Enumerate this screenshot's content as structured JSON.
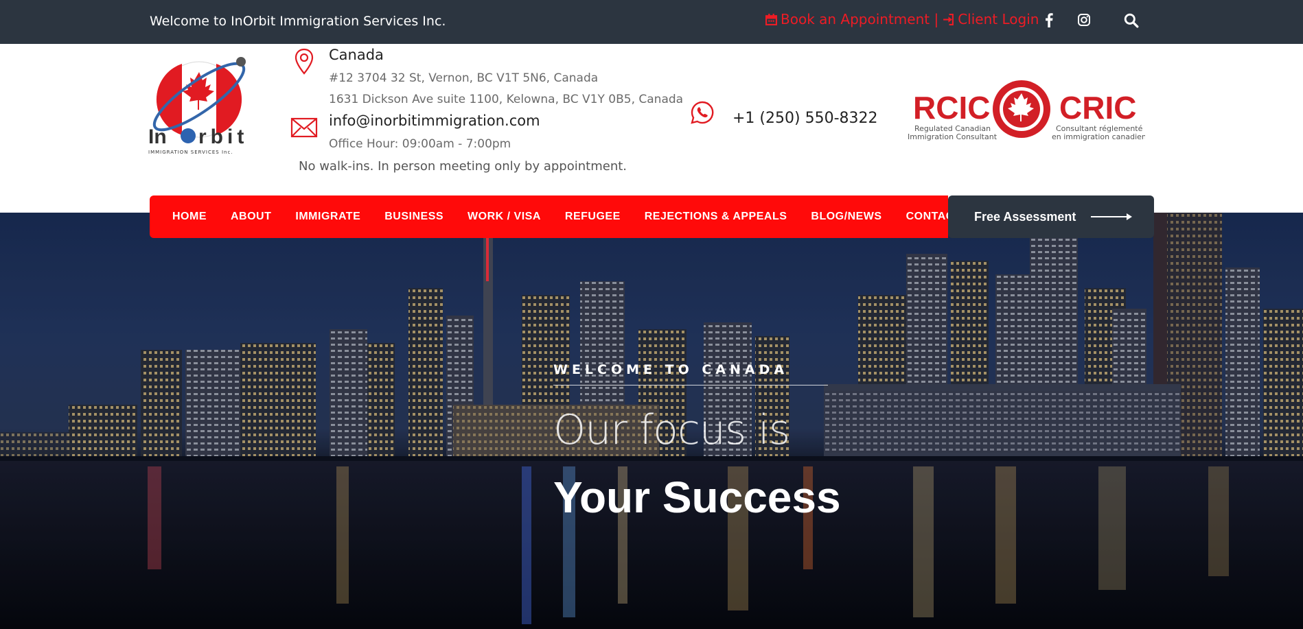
{
  "topbar": {
    "welcome": "Welcome to InOrbit Immigration Services Inc.",
    "book_label": "Book an Appointment |",
    "login_label": "Client Login",
    "icons": [
      "calendar-icon",
      "sign-in-icon",
      "facebook-icon",
      "instagram-icon",
      "search-icon"
    ]
  },
  "header": {
    "country": "Canada",
    "address1": "#12 3704 32 St, Vernon, BC V1T 5N6, Canada",
    "address2": "1631 Dickson Ave suite 1100, Kelowna, BC V1Y 0B5, Canada",
    "email": "info@inorbitimmigration.com",
    "hours": "Office Hour: 09:00am - 7:00pm",
    "walkin": "No walk-ins. In person meeting only by appointment.",
    "phone": "+1 (250) 550-8322",
    "logo": {
      "name_part1": "In",
      "name_part2": "rbit",
      "tagline": "IMMIGRATION SERVICES Inc."
    },
    "rcic": {
      "left": "RCIC",
      "right": "CRIC",
      "left_sub1": "Regulated Canadian",
      "left_sub2": "Immigration Consultant",
      "right_sub1": "Consultant réglementé",
      "right_sub2": "en immigration canadienne"
    }
  },
  "nav": {
    "items": [
      "HOME",
      "ABOUT",
      "IMMIGRATE",
      "BUSINESS",
      "WORK / VISA",
      "REFUGEE",
      "REJECTIONS & APPEALS",
      "BLOG/NEWS",
      "CONTACTS"
    ],
    "cta": "Free Assessment"
  },
  "hero": {
    "kicker": "WELCOME TO CANADA",
    "line1": "Our focus is",
    "line2": "Your Success"
  },
  "colors": {
    "brand_red": "#ff0a0a",
    "dark": "#2c3540",
    "link_red": "#ee1c25"
  }
}
